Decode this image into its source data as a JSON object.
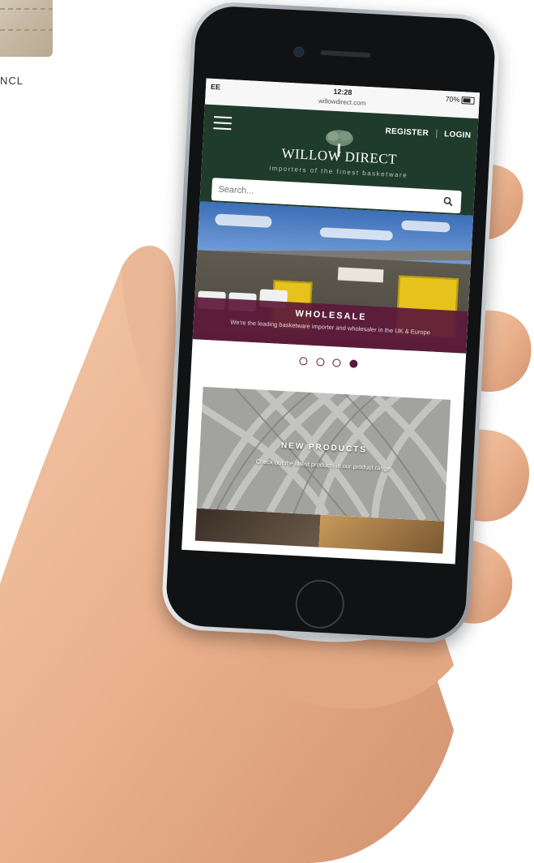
{
  "background": {
    "caption": "NCL"
  },
  "status_bar": {
    "carrier": "EE",
    "time": "12:28",
    "url": "willowdirect.com",
    "battery": "70%"
  },
  "header": {
    "register_label": "REGISTER",
    "login_label": "LOGIN",
    "brand": "WILLOW DIRECT",
    "tagline": "importers of the finest basketware"
  },
  "search": {
    "placeholder": "Search..."
  },
  "hero": {
    "title": "WHOLESALE",
    "subtitle": "We're the leading basketware importer and wholesaler in the UK & Europe",
    "slides": 4,
    "active_slide": 4
  },
  "tile": {
    "title": "NEW PRODUCTS",
    "subtitle": "Check out the latest products in our product range"
  },
  "colors": {
    "header_green": "#1f3b2b",
    "banner_plum": "#5c193a",
    "door_yellow": "#e6c21c"
  }
}
